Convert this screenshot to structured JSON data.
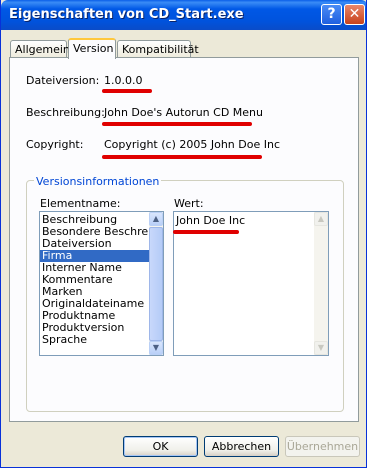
{
  "window": {
    "title": "Eigenschaften von CD_Start.exe",
    "help_button": "?",
    "close_button": "✕"
  },
  "tabs": [
    {
      "label": "Allgemein"
    },
    {
      "label": "Version"
    },
    {
      "label": "Kompatibilität"
    }
  ],
  "fields": {
    "version_label": "Dateiversion:",
    "version_value": "1.0.0.0",
    "description_label": "Beschreibung:",
    "description_value": "John Doe's Autorun CD Menu",
    "copyright_label": "Copyright:",
    "copyright_value": "Copyright (c) 2005 John Doe Inc"
  },
  "version_info": {
    "group_title": "Versionsinformationen",
    "element_label": "Elementname:",
    "value_label": "Wert:",
    "items": [
      "Beschreibung",
      "Besondere Beschreibung",
      "Dateiversion",
      "Firma",
      "Interner Name",
      "Kommentare",
      "Marken",
      "Originaldateiname",
      "Produktname",
      "Produktversion",
      "Sprache"
    ],
    "selected_item": "Firma",
    "value_text": "John Doe Inc"
  },
  "buttons": {
    "ok": "OK",
    "cancel": "Abbrechen",
    "apply": "Übernehmen"
  },
  "colors": {
    "annotation_red": "#e00000",
    "selection_blue": "#316ac5",
    "titlebar_blue": "#0058e6"
  }
}
